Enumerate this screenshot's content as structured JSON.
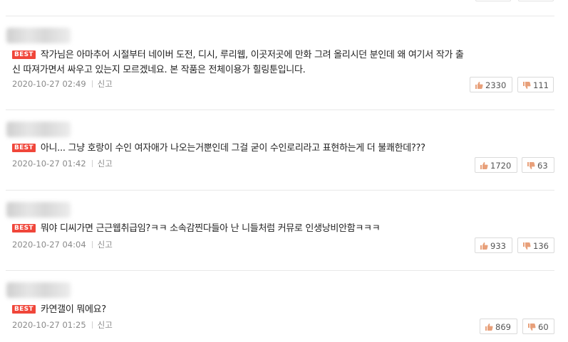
{
  "comments": [
    {
      "badge": "BEST",
      "text_line1": "작가님은 아마추어 시절부터 네이버 도전, 디시, 루리웹, 이곳저곳에 만화 그려 올리시던 분인데 왜 여기서 작가 출",
      "text_line2": "신 따져가면서 싸우고 있는지 모르겠네요. 본 작품은 전체이용가 힐링툰입니다.",
      "date": "2020-10-27 02:49",
      "report_label": "신고",
      "likes": "2330",
      "dislikes": "111"
    },
    {
      "badge": "BEST",
      "text_line1": "아니... 그냥 호랑이 수인 여자애가 나오는거뿐인데 그걸 굳이 수인로리라고 표현하는게 더 불쾌한데???",
      "date": "2020-10-27 01:42",
      "report_label": "신고",
      "likes": "1720",
      "dislikes": "63"
    },
    {
      "badge": "BEST",
      "text_line1": "뭐야 디씨가면 근근웹취급임?ㅋㅋ 소속감찐다들아 난 니들처럼 커뮤로 인생낭비안함ㅋㅋㅋ",
      "date": "2020-10-27 04:04",
      "report_label": "신고",
      "likes": "933",
      "dislikes": "136"
    },
    {
      "badge": "BEST",
      "text_line1": "카연갤이 뭐에요?",
      "date": "2020-10-27 01:25",
      "report_label": "신고",
      "likes": "869",
      "dislikes": "60"
    }
  ],
  "colors": {
    "best_badge": "#f0463a",
    "like_icon": "#e8a07a",
    "dislike_icon": "#e8a07a"
  },
  "icons": {
    "like": "thumbs-up-icon",
    "dislike": "thumbs-down-icon"
  }
}
